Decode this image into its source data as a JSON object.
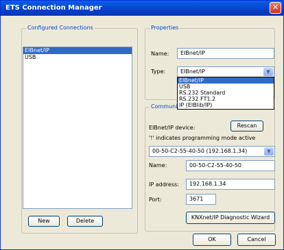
{
  "window": {
    "title": "ETS Connection Manager",
    "close_label": "✕"
  },
  "configured": {
    "title": "Configured Connections",
    "items": [
      "EIBnet/IP",
      "USB"
    ],
    "new_label": "New",
    "delete_label": "Delete"
  },
  "properties": {
    "title": "Properties",
    "name_label": "Name:",
    "name_value": "EIBnet/IP",
    "type_label": "Type:",
    "type_value": "EIBnet/IP",
    "type_options": [
      "EIBnet/IP",
      "USB",
      "RS.232 Standard",
      "RS.232 FT1.2",
      "IP (EIBlib/IP)"
    ]
  },
  "communication": {
    "title": "Communication",
    "device_label": "EIBnet/IP device:",
    "rescan_label": "Rescan",
    "hint": "'!' indicates programming mode active",
    "device_value": "00-50-C2-55-40-50 (192.168.1.34)",
    "name_label": "Name:",
    "name_value": "00-50-C2-55-40-50",
    "ip_label": "IP address:",
    "ip_value": "192.168.1.34",
    "port_label": "Port:",
    "port_value": "3671",
    "wizard_label": "KNXnet/IP Diagnostic Wizard"
  },
  "footer": {
    "ok_label": "OK",
    "cancel_label": "Cancel"
  }
}
